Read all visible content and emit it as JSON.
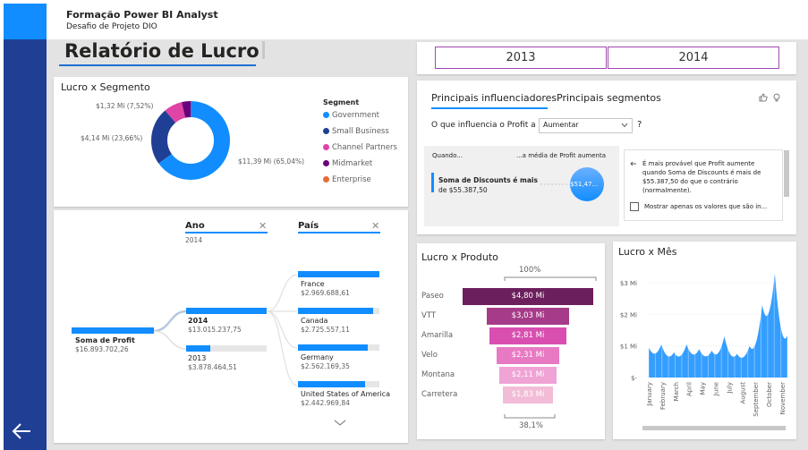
{
  "header": {
    "title": "Formação Power BI Analyst",
    "subtitle": "Desafio de Projeto DIO"
  },
  "page_title": "Relatório de Lucro",
  "year_slicer": [
    "2013",
    "2014"
  ],
  "segment_chart": {
    "title": "Lucro x Segmento",
    "legend_title": "Segment",
    "labels": [
      "$1,32 Mi (7,52%)",
      "$4,14 Mi (23,66%)",
      "$11,39 Mi (65,04%)"
    ],
    "legend": [
      {
        "name": "Government",
        "color": "#118dff"
      },
      {
        "name": "Small Business",
        "color": "#1f3f94"
      },
      {
        "name": "Channel Partners",
        "color": "#e044a7"
      },
      {
        "name": "Midmarket",
        "color": "#6b007b"
      },
      {
        "name": "Enterprise",
        "color": "#e66c37"
      }
    ]
  },
  "decomp_tree": {
    "ano_header": "Ano",
    "ano_sub": "2014",
    "pais_header": "País",
    "close": "✕",
    "root": {
      "name": "Soma de Profit",
      "value": "$16.893.702,26"
    },
    "years": [
      {
        "name": "2014",
        "value": "$13.015.237,75",
        "fraction": 1.0
      },
      {
        "name": "2013",
        "value": "$3.878.464,51",
        "fraction": 0.3
      }
    ],
    "countries": [
      {
        "name": "France",
        "value": "$2.969.688,61",
        "fraction": 1.0
      },
      {
        "name": "Canada",
        "value": "$2.725.557,11",
        "fraction": 0.92
      },
      {
        "name": "Germany",
        "value": "$2.562.169,35",
        "fraction": 0.86
      },
      {
        "name": "United States of America",
        "value": "$2.442.969,84",
        "fraction": 0.82
      }
    ]
  },
  "influencers": {
    "tab1": "Principais influenciadores",
    "tab2": "Principais segmentos",
    "question": "O que influencia o Profit a",
    "select_value": "Aumentar",
    "help": "?",
    "col_when": "Quando...",
    "col_avg": "...a média de Profit aumenta",
    "factor_name": "Soma de Discounts é mais",
    "factor_detail": "de $55.387,50",
    "bubble_value": "$51,47...",
    "explain": "É mais provável que Profit aumente quando Soma de Discounts é mais de $55.387,50 do que o contrário (normalmente).",
    "checkbox_label": "Mostrar apenas os valores que são in..."
  },
  "product_chart": {
    "title": "Lucro x Produto",
    "top_pct": "100%",
    "bottom_pct": "38,1%",
    "items": [
      {
        "name": "Paseo",
        "label": "$4,80 Mi",
        "value": 4.8,
        "color": "#6b1f5c"
      },
      {
        "name": "VTT",
        "label": "$3,03 Mi",
        "value": 3.03,
        "color": "#a63c89"
      },
      {
        "name": "Amarilla",
        "label": "$2,81 Mi",
        "value": 2.81,
        "color": "#d94fb0"
      },
      {
        "name": "Velo",
        "label": "$2,31 Mi",
        "value": 2.31,
        "color": "#e87ac3"
      },
      {
        "name": "Montana",
        "label": "$2,11 Mi",
        "value": 2.11,
        "color": "#f0a3d5"
      },
      {
        "name": "Carretera",
        "label": "$1,83 Mi",
        "value": 1.83,
        "color": "#f3bcd6"
      }
    ]
  },
  "chart_data": {
    "type": "area",
    "title": "Lucro x Mês",
    "categories": [
      "January",
      "February",
      "March",
      "April",
      "May",
      "June",
      "July",
      "August",
      "September",
      "October",
      "November"
    ],
    "y_ticks": [
      "$-",
      "$1 Mi",
      "$2 Mi",
      "$3 Mi"
    ],
    "ylim": [
      0,
      3.4
    ],
    "values": [
      0.95,
      1.05,
      0.8,
      1.05,
      0.9,
      0.85,
      1.3,
      0.75,
      1.0,
      2.3,
      3.3,
      1.35
    ],
    "color": "#118dff"
  }
}
